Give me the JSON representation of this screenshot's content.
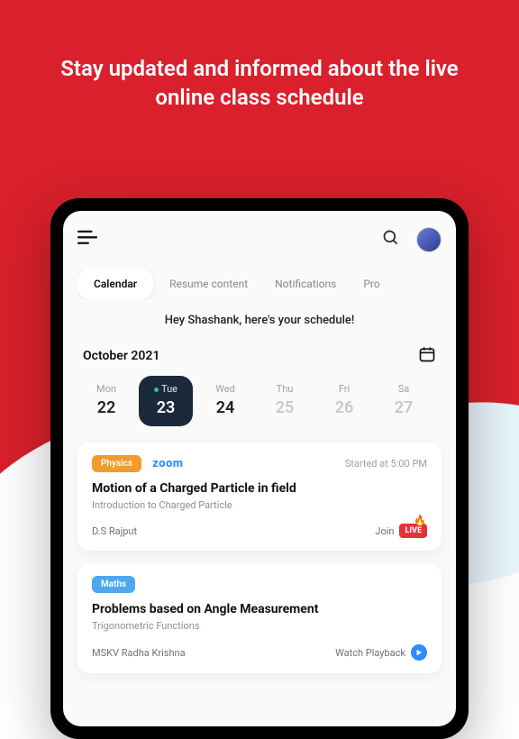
{
  "hero": "Stay updated and informed about the live online class schedule",
  "tabs": {
    "t0": "Calendar",
    "t1": "Resume content",
    "t2": "Notifications",
    "t3": "Pro"
  },
  "greeting": "Hey Shashank, here's your schedule!",
  "month": "October 2021",
  "days": {
    "d0": {
      "dow": "Mon",
      "num": "22"
    },
    "d1": {
      "dow": "Tue",
      "num": "23"
    },
    "d2": {
      "dow": "Wed",
      "num": "24"
    },
    "d3": {
      "dow": "Thu",
      "num": "25"
    },
    "d4": {
      "dow": "Fri",
      "num": "26"
    },
    "d5": {
      "dow": "Sa",
      "num": "27"
    }
  },
  "card1": {
    "badge": "Physics",
    "provider": "zoom",
    "started": "Started at 5:00 PM",
    "title": "Motion of a Charged Particle in field",
    "subtitle": "Introduction to Charged Particle",
    "teacher": "D.S Rajput",
    "join": "Join",
    "live": "LIVE"
  },
  "card2": {
    "badge": "Maths",
    "title": "Problems based on Angle Measurement",
    "subtitle": "Trigonometric Functions",
    "teacher": "MSKV Radha Krishna",
    "watch": "Watch Playback"
  }
}
